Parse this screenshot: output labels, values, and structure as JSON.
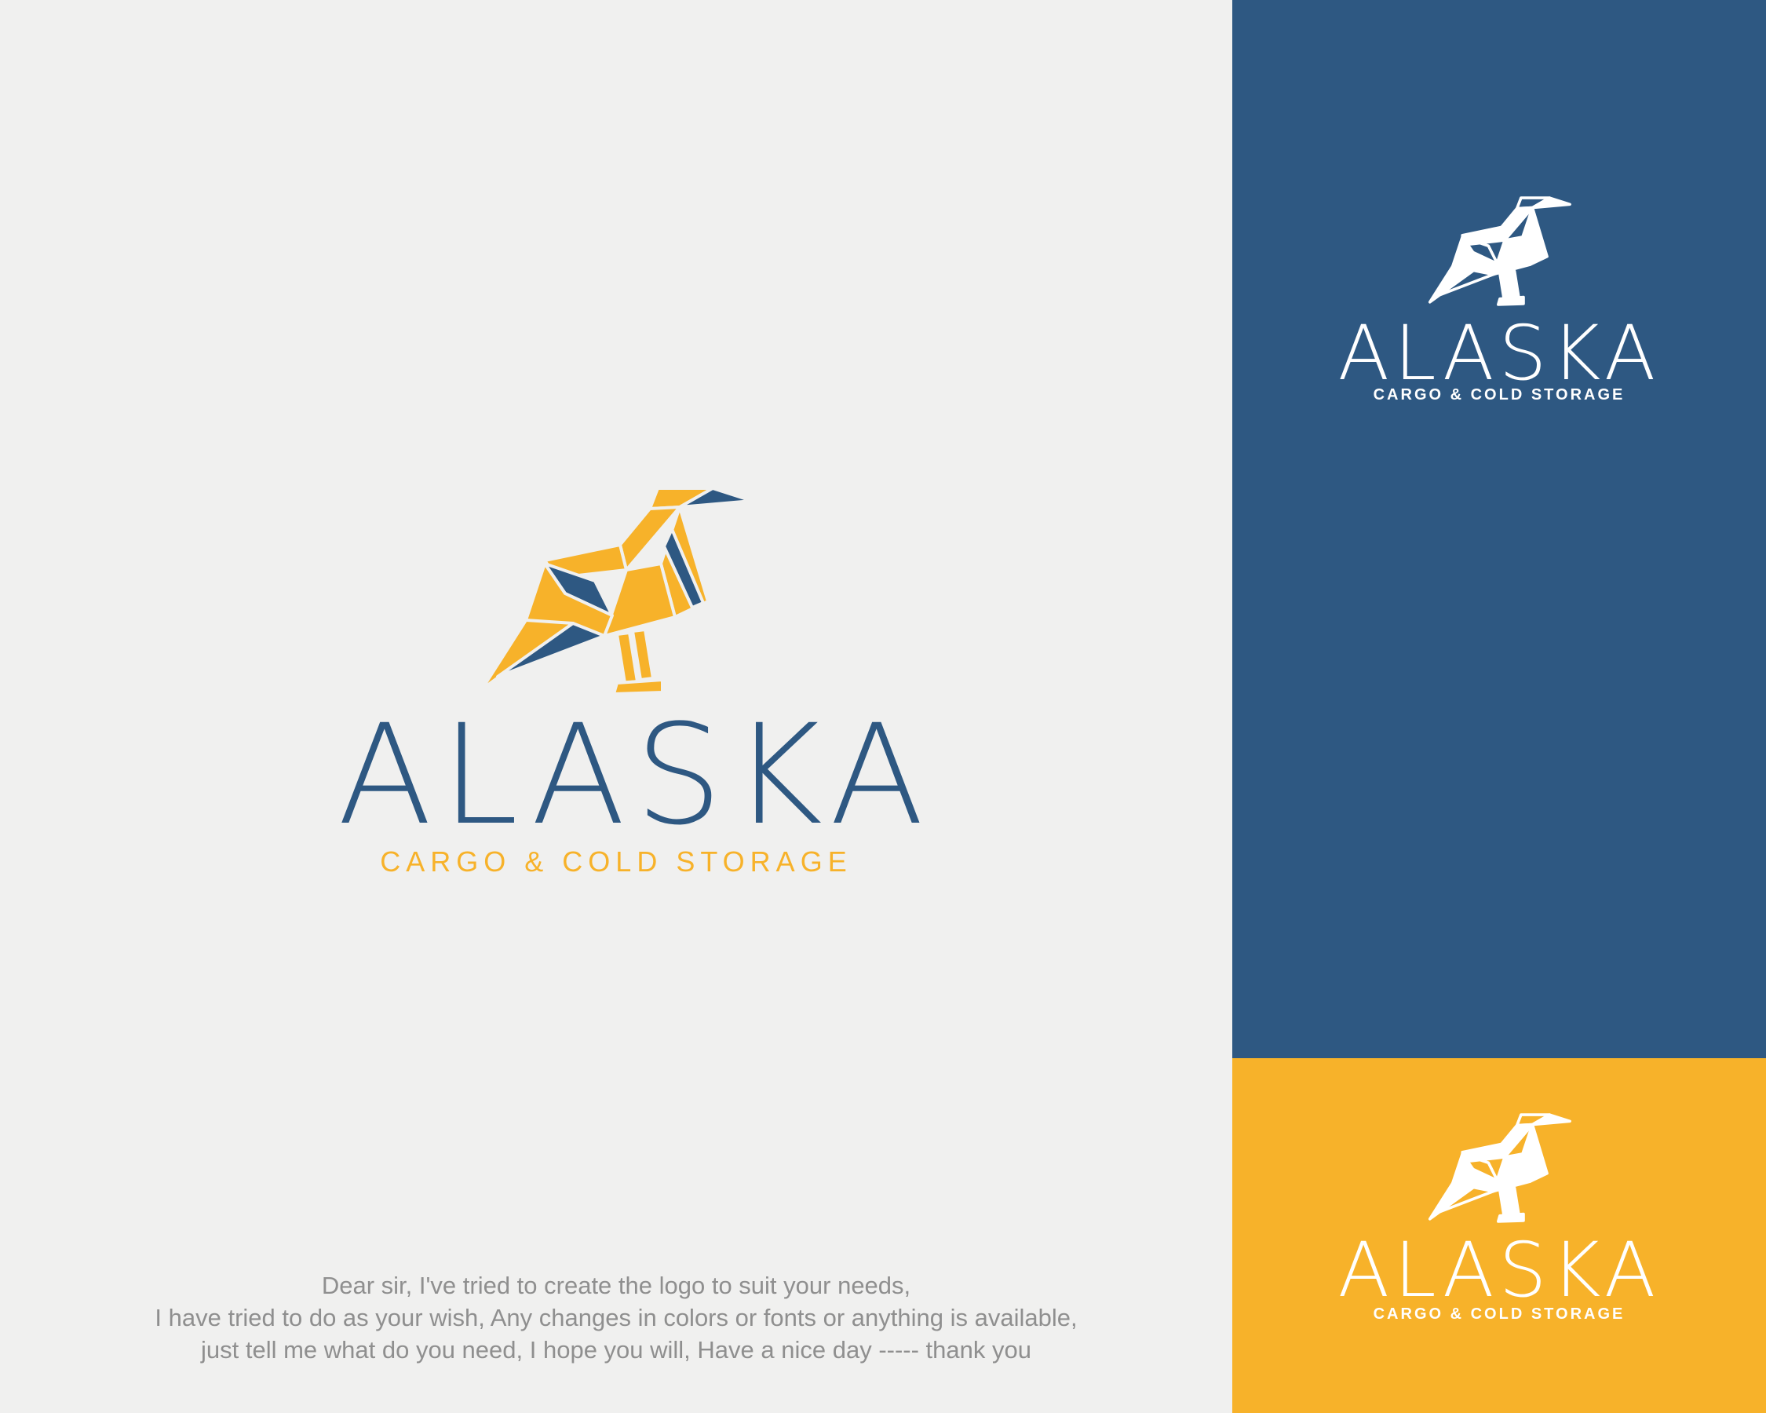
{
  "brand": {
    "name": "ALASKA",
    "tagline": "CARGO & COLD STORAGE"
  },
  "colors": {
    "navy": "#2e5882",
    "gold": "#f7b22a",
    "white": "#ffffff",
    "paper": "#f0f0ef",
    "message_text": "#8f8f8f"
  },
  "icons": {
    "logo_symbol": "origami-bird-icon"
  },
  "message": {
    "line1": "Dear sir, I've tried to create the logo to suit your needs,",
    "line2": "I have tried to do as your wish, Any changes in colors or fonts or anything is available,",
    "line3": "just tell me what do you need, I hope you will, Have a nice day ----- thank you"
  }
}
